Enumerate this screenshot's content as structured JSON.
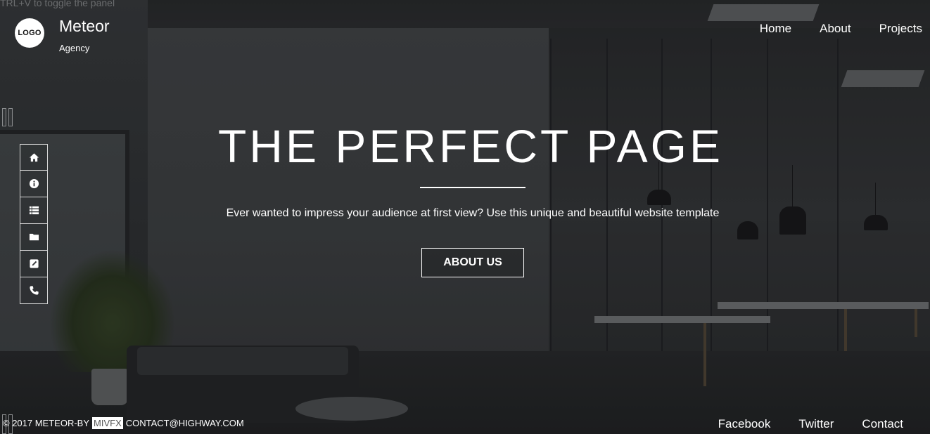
{
  "hint": "TRL+V to toggle the panel",
  "brand": {
    "logo_text": "LOGO",
    "name": "Meteor",
    "tagline": "Agency"
  },
  "top_nav": [
    {
      "label": "Home"
    },
    {
      "label": "About"
    },
    {
      "label": "Projects"
    }
  ],
  "side_nav": [
    {
      "icon": "home-icon"
    },
    {
      "icon": "info-icon"
    },
    {
      "icon": "list-icon"
    },
    {
      "icon": "folder-icon"
    },
    {
      "icon": "edit-icon"
    },
    {
      "icon": "phone-icon"
    }
  ],
  "hero": {
    "title": "THE PERFECT PAGE",
    "subtitle": "Ever wanted to impress your audience at first view? Use this unique and beautiful website template",
    "button_label": "ABOUT US"
  },
  "footer": {
    "copyright_prefix": "© 2017 METEOR-BY",
    "copyright_highlight": "MIVFX",
    "copyright_suffix": "CONTACT@HIGHWAY.COM",
    "links": [
      {
        "label": "Facebook"
      },
      {
        "label": "Twitter"
      },
      {
        "label": "Contact"
      }
    ]
  },
  "colors": {
    "text": "#ffffff",
    "overlay": "#000000",
    "button_border": "#ffffff"
  }
}
